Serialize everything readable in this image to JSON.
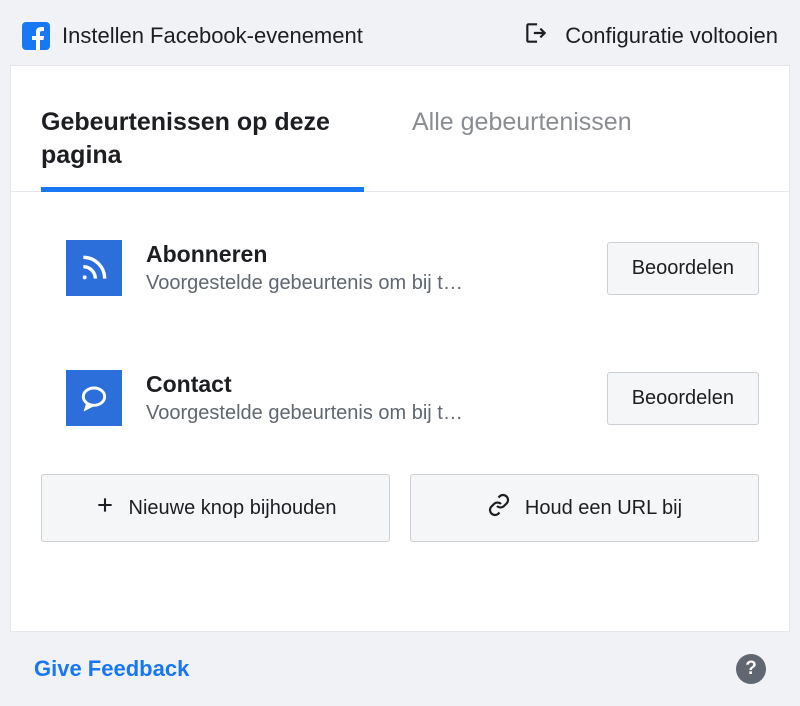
{
  "header": {
    "title": "Instellen Facebook-evenement",
    "complete_config": "Configuratie voltooien"
  },
  "tabs": [
    {
      "label": "Gebeurtenissen op deze pagina",
      "active": true
    },
    {
      "label": "Alle gebeurtenissen",
      "active": false
    }
  ],
  "events": [
    {
      "icon": "rss",
      "title": "Abonneren",
      "subtitle": "Voorgestelde gebeurtenis om bij t…",
      "action": "Beoordelen"
    },
    {
      "icon": "chat",
      "title": "Contact",
      "subtitle": "Voorgestelde gebeurtenis om bij t…",
      "action": "Beoordelen"
    }
  ],
  "actions": {
    "track_button": "Nieuwe knop bijhouden",
    "track_url": "Houd een URL bij"
  },
  "footer": {
    "feedback": "Give Feedback"
  }
}
